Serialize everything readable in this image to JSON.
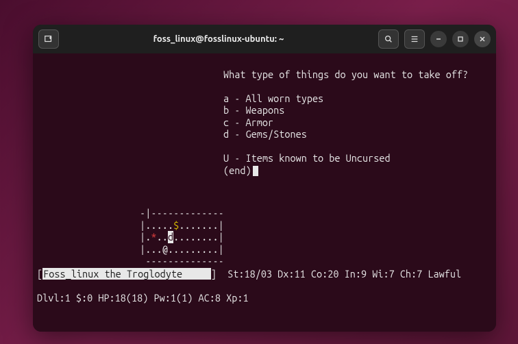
{
  "titlebar": {
    "title": "foss_linux@fosslinux-ubuntu: ~"
  },
  "menu": {
    "prompt": "What type of things do you want to take off?",
    "items": [
      {
        "key": "a",
        "label": "All worn types"
      },
      {
        "key": "b",
        "label": "Weapons"
      },
      {
        "key": "c",
        "label": "Armor"
      },
      {
        "key": "d",
        "label": "Gems/Stones"
      }
    ],
    "extra": {
      "key": "U",
      "label": "Items known to be Uncursed"
    },
    "end": "(end)"
  },
  "map": {
    "rows": [
      [
        {
          "t": "-"
        },
        {
          "t": "|"
        },
        {
          "t": "-"
        },
        {
          "t": "-"
        },
        {
          "t": "-"
        },
        {
          "t": "-"
        },
        {
          "t": "-"
        },
        {
          "t": "-"
        },
        {
          "t": "-"
        },
        {
          "t": "-"
        },
        {
          "t": "-"
        },
        {
          "t": "-"
        },
        {
          "t": "-"
        },
        {
          "t": "-"
        },
        {
          "t": "-"
        }
      ],
      [
        {
          "t": "|"
        },
        {
          "t": "."
        },
        {
          "t": "."
        },
        {
          "t": "."
        },
        {
          "t": "."
        },
        {
          "t": "."
        },
        {
          "t": "$",
          "c": "yellow"
        },
        {
          "t": "."
        },
        {
          "t": "."
        },
        {
          "t": "."
        },
        {
          "t": "."
        },
        {
          "t": "."
        },
        {
          "t": "."
        },
        {
          "t": "."
        },
        {
          "t": "|"
        }
      ],
      [
        {
          "t": "|"
        },
        {
          "t": "."
        },
        {
          "t": "*",
          "c": "red"
        },
        {
          "t": "."
        },
        {
          "t": "."
        },
        {
          "t": "d",
          "c": "hl"
        },
        {
          "t": "."
        },
        {
          "t": "."
        },
        {
          "t": "."
        },
        {
          "t": "."
        },
        {
          "t": "."
        },
        {
          "t": "."
        },
        {
          "t": "."
        },
        {
          "t": "."
        },
        {
          "t": "|"
        }
      ],
      [
        {
          "t": "|"
        },
        {
          "t": "."
        },
        {
          "t": "."
        },
        {
          "t": "."
        },
        {
          "t": "@"
        },
        {
          "t": "."
        },
        {
          "t": "."
        },
        {
          "t": "."
        },
        {
          "t": "."
        },
        {
          "t": "."
        },
        {
          "t": "."
        },
        {
          "t": "."
        },
        {
          "t": "."
        },
        {
          "t": "."
        },
        {
          "t": "|"
        }
      ],
      [
        {
          "t": " "
        },
        {
          "t": "-"
        },
        {
          "t": "-"
        },
        {
          "t": "-"
        },
        {
          "t": "-"
        },
        {
          "t": "-"
        },
        {
          "t": "-"
        },
        {
          "t": "-"
        },
        {
          "t": "-"
        },
        {
          "t": "-"
        },
        {
          "t": "-"
        },
        {
          "t": "-"
        },
        {
          "t": "-"
        },
        {
          "t": "-"
        },
        {
          "t": "-"
        }
      ]
    ]
  },
  "status": {
    "name_line_prefix": "[",
    "name": "Foss_linux the Troglodyte     ",
    "name_line_suffix": "]  St:18/03 Dx:11 Co:20 In:9 Wi:7 Ch:7 Lawful",
    "line2": "Dlvl:1 $:0 HP:18(18) Pw:1(1) AC:8 Xp:1"
  }
}
